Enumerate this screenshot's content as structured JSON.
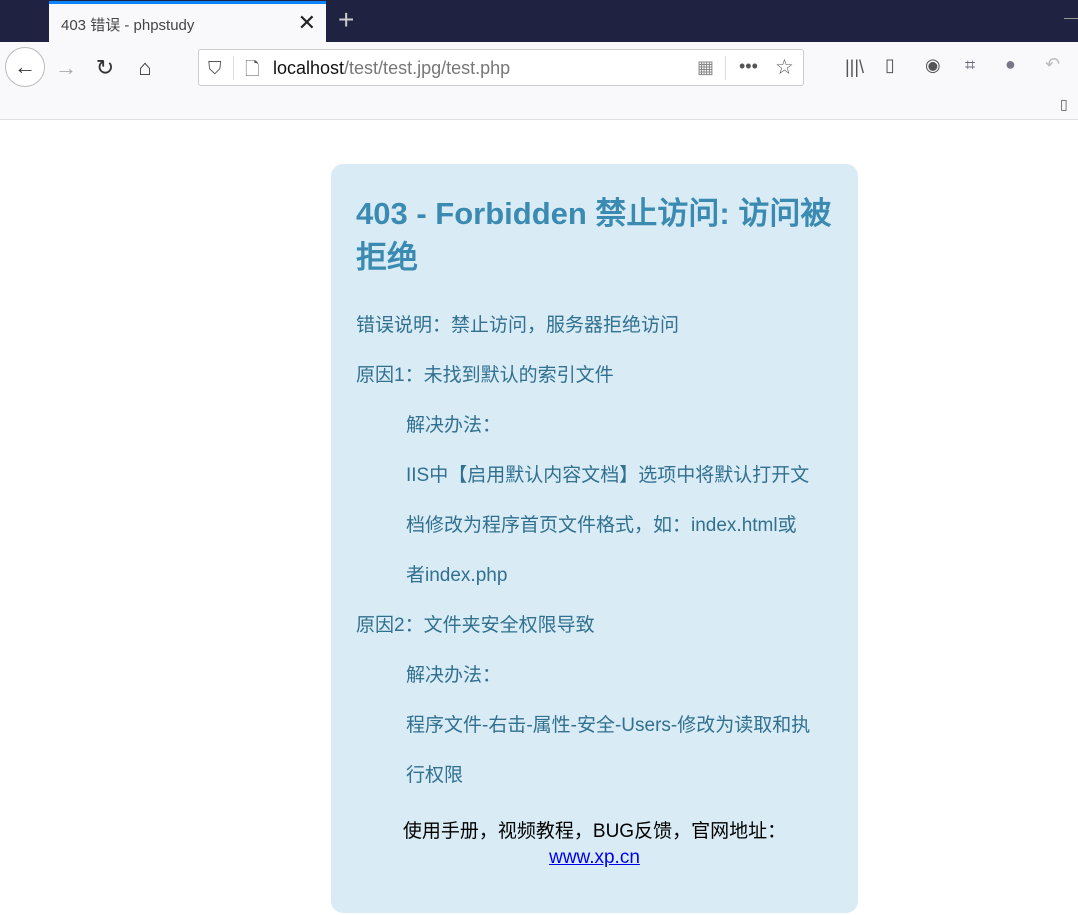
{
  "browser": {
    "tab_title": "403 错误 - phpstudy",
    "url_host": "localhost",
    "url_path": "/test/test.jpg/test.php"
  },
  "page": {
    "title": "403 - Forbidden 禁止访问: 访问被拒绝",
    "description": "错误说明：禁止访问，服务器拒绝访问",
    "reason1": "原因1：未找到默认的索引文件",
    "solution_label1": "解决办法：",
    "solution1_lines": [
      "IIS中【启用默认内容文档】选项中将默认打开文",
      "档修改为程序首页文件格式，如：index.html或",
      "者index.php"
    ],
    "reason2": "原因2：文件夹安全权限导致",
    "solution_label2": "解决办法：",
    "solution2_lines": [
      "程序文件-右击-属性-安全-Users-修改为读取和执",
      "行权限"
    ],
    "footer_text": "使用手册，视频教程，BUG反馈，官网地址：",
    "footer_link": "www.xp.cn"
  }
}
